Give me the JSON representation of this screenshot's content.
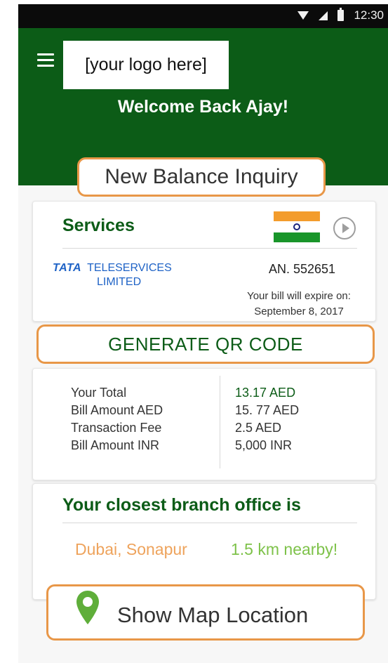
{
  "status_bar": {
    "time": "12:30",
    "icons": [
      "wifi-icon",
      "signal-icon",
      "battery-icon"
    ]
  },
  "header": {
    "menu_icon": "hamburger-menu-icon",
    "logo_text": "[your logo here]",
    "welcome": "Welcome Back Ajay!",
    "background_color": "#0c5c17"
  },
  "new_balance_button": "New Balance Inquiry",
  "services": {
    "title": "Services",
    "flag_icon": "india-flag-icon",
    "next_icon": "arrow-right-circle-icon",
    "provider": {
      "brand": "TATA",
      "line1": "TELESERVICES",
      "line2": "LIMITED"
    },
    "account_number": "AN. 552651",
    "expire_label": "Your bill will expire on:",
    "expire_date": "September 8, 2017"
  },
  "generate_button": "GENERATE QR CODE",
  "bill": {
    "rows": [
      {
        "label": "Your Total",
        "value": "13.17 AED"
      },
      {
        "label": "Bill Amount AED",
        "value": "15. 77 AED"
      },
      {
        "label": "Transaction Fee",
        "value": "2.5 AED"
      },
      {
        "label": "Bill Amount INR",
        "value": "5,000 INR"
      }
    ]
  },
  "branch": {
    "title": "Your closest branch office is",
    "city": "Dubai, Sonapur",
    "distance": "1.5 km nearby!"
  },
  "map_button": {
    "label": "Show Map Location",
    "icon": "location-pin-icon"
  },
  "colors": {
    "primary_green": "#0c5c17",
    "accent_orange": "#e89748",
    "light_green": "#7ec24a",
    "provider_blue": "#1f63c6"
  }
}
